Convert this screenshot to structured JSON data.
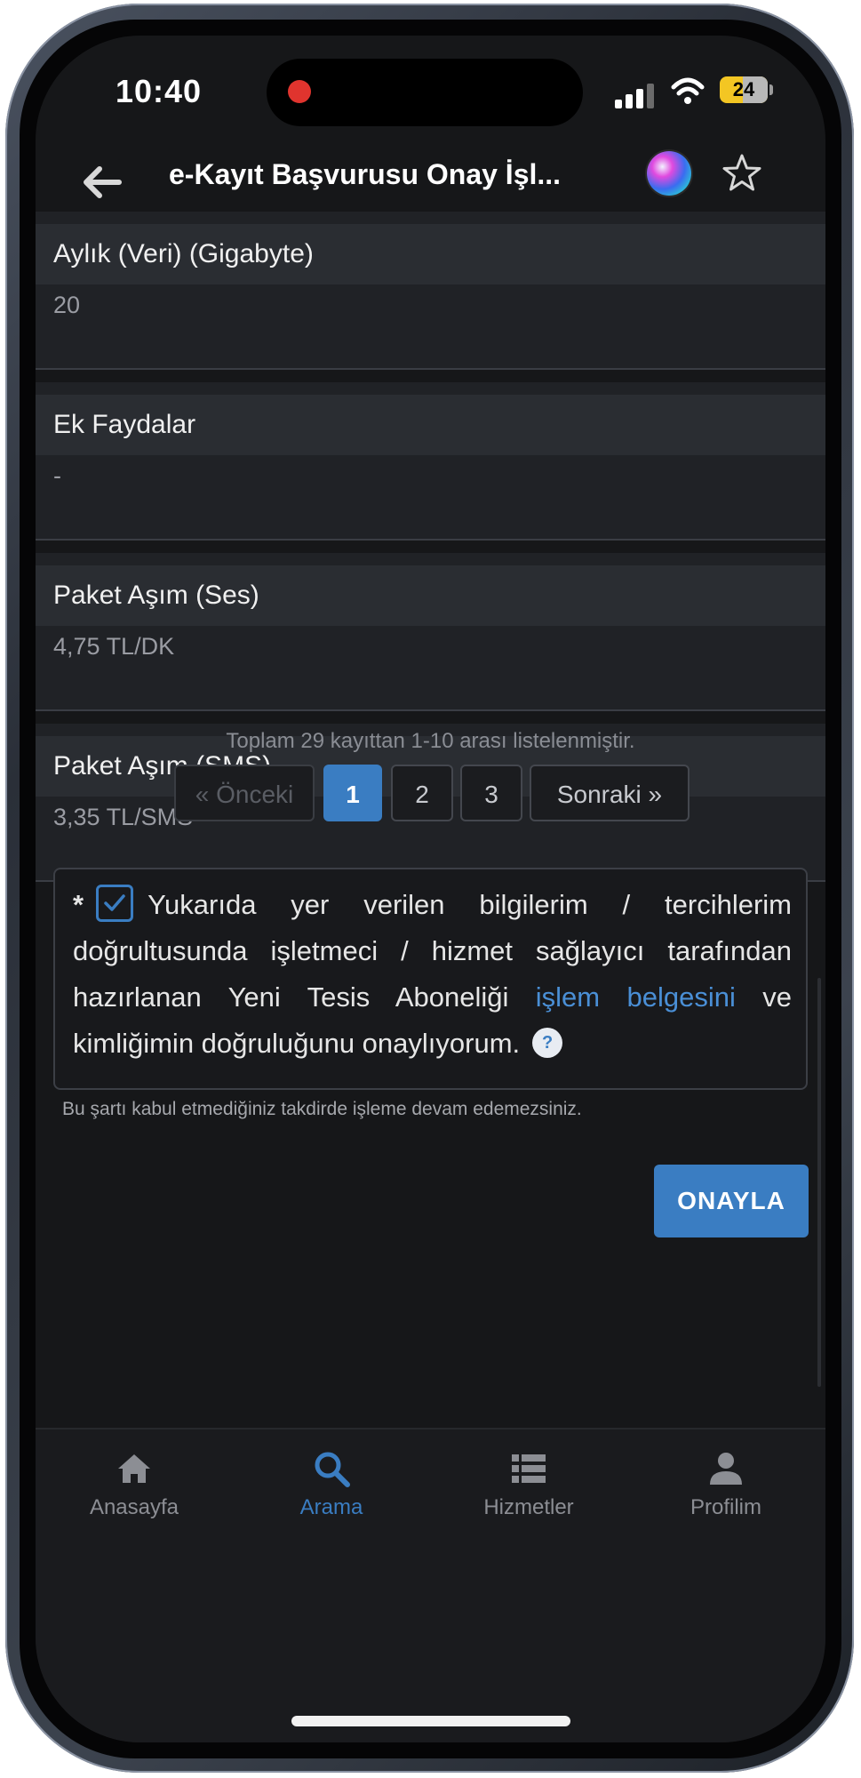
{
  "status_bar": {
    "time": "10:40",
    "battery": "24",
    "recording_color": "#e0342e"
  },
  "header": {
    "title": "e-Kayıt Başvurusu Onay İşl...",
    "back_icon": "arrow-left-icon",
    "assistant_icon": "siri-icon",
    "favorite_icon": "star-icon"
  },
  "details": [
    {
      "label": "Aylık (Veri) (Gigabyte)",
      "value": "20"
    },
    {
      "label": "Ek Faydalar",
      "value": "-"
    },
    {
      "label": "Paket Aşım (Ses)",
      "value": "4,75 TL/DK"
    },
    {
      "label": "Paket Aşım (SMS)",
      "value": "3,35 TL/SMS"
    }
  ],
  "pagination": {
    "info": "Toplam 29 kayıttan 1-10 arası listelenmiştir.",
    "prev": "« Önceki",
    "pages": [
      "1",
      "2",
      "3"
    ],
    "active_page": "1",
    "next": "Sonraki »"
  },
  "consent": {
    "asterisk": "*",
    "checked": true,
    "text_before": "Yukarıda yer verilen bilgilerim / tercihlerim doğrultusunda işletmeci / hizmet sağlayıcı tarafından hazırlanan Yeni Tesis Aboneliği",
    "link": "işlem belgesini",
    "text_after": "ve kimliğimin doğruluğunu onaylıyorum.",
    "help": "?",
    "note": "Bu şartı kabul etmediğiniz takdirde işleme devam edemezsiniz."
  },
  "approve_button": "ONAYLA",
  "tabs": [
    {
      "label": "Anasayfa",
      "icon": "home-icon"
    },
    {
      "label": "Arama",
      "icon": "search-icon"
    },
    {
      "label": "Hizmetler",
      "icon": "list-icon"
    },
    {
      "label": "Profilim",
      "icon": "person-icon"
    }
  ],
  "active_tab": "Arama",
  "colors": {
    "accent": "#3a7dc2",
    "background": "#161719",
    "battery": "#f3c623"
  }
}
